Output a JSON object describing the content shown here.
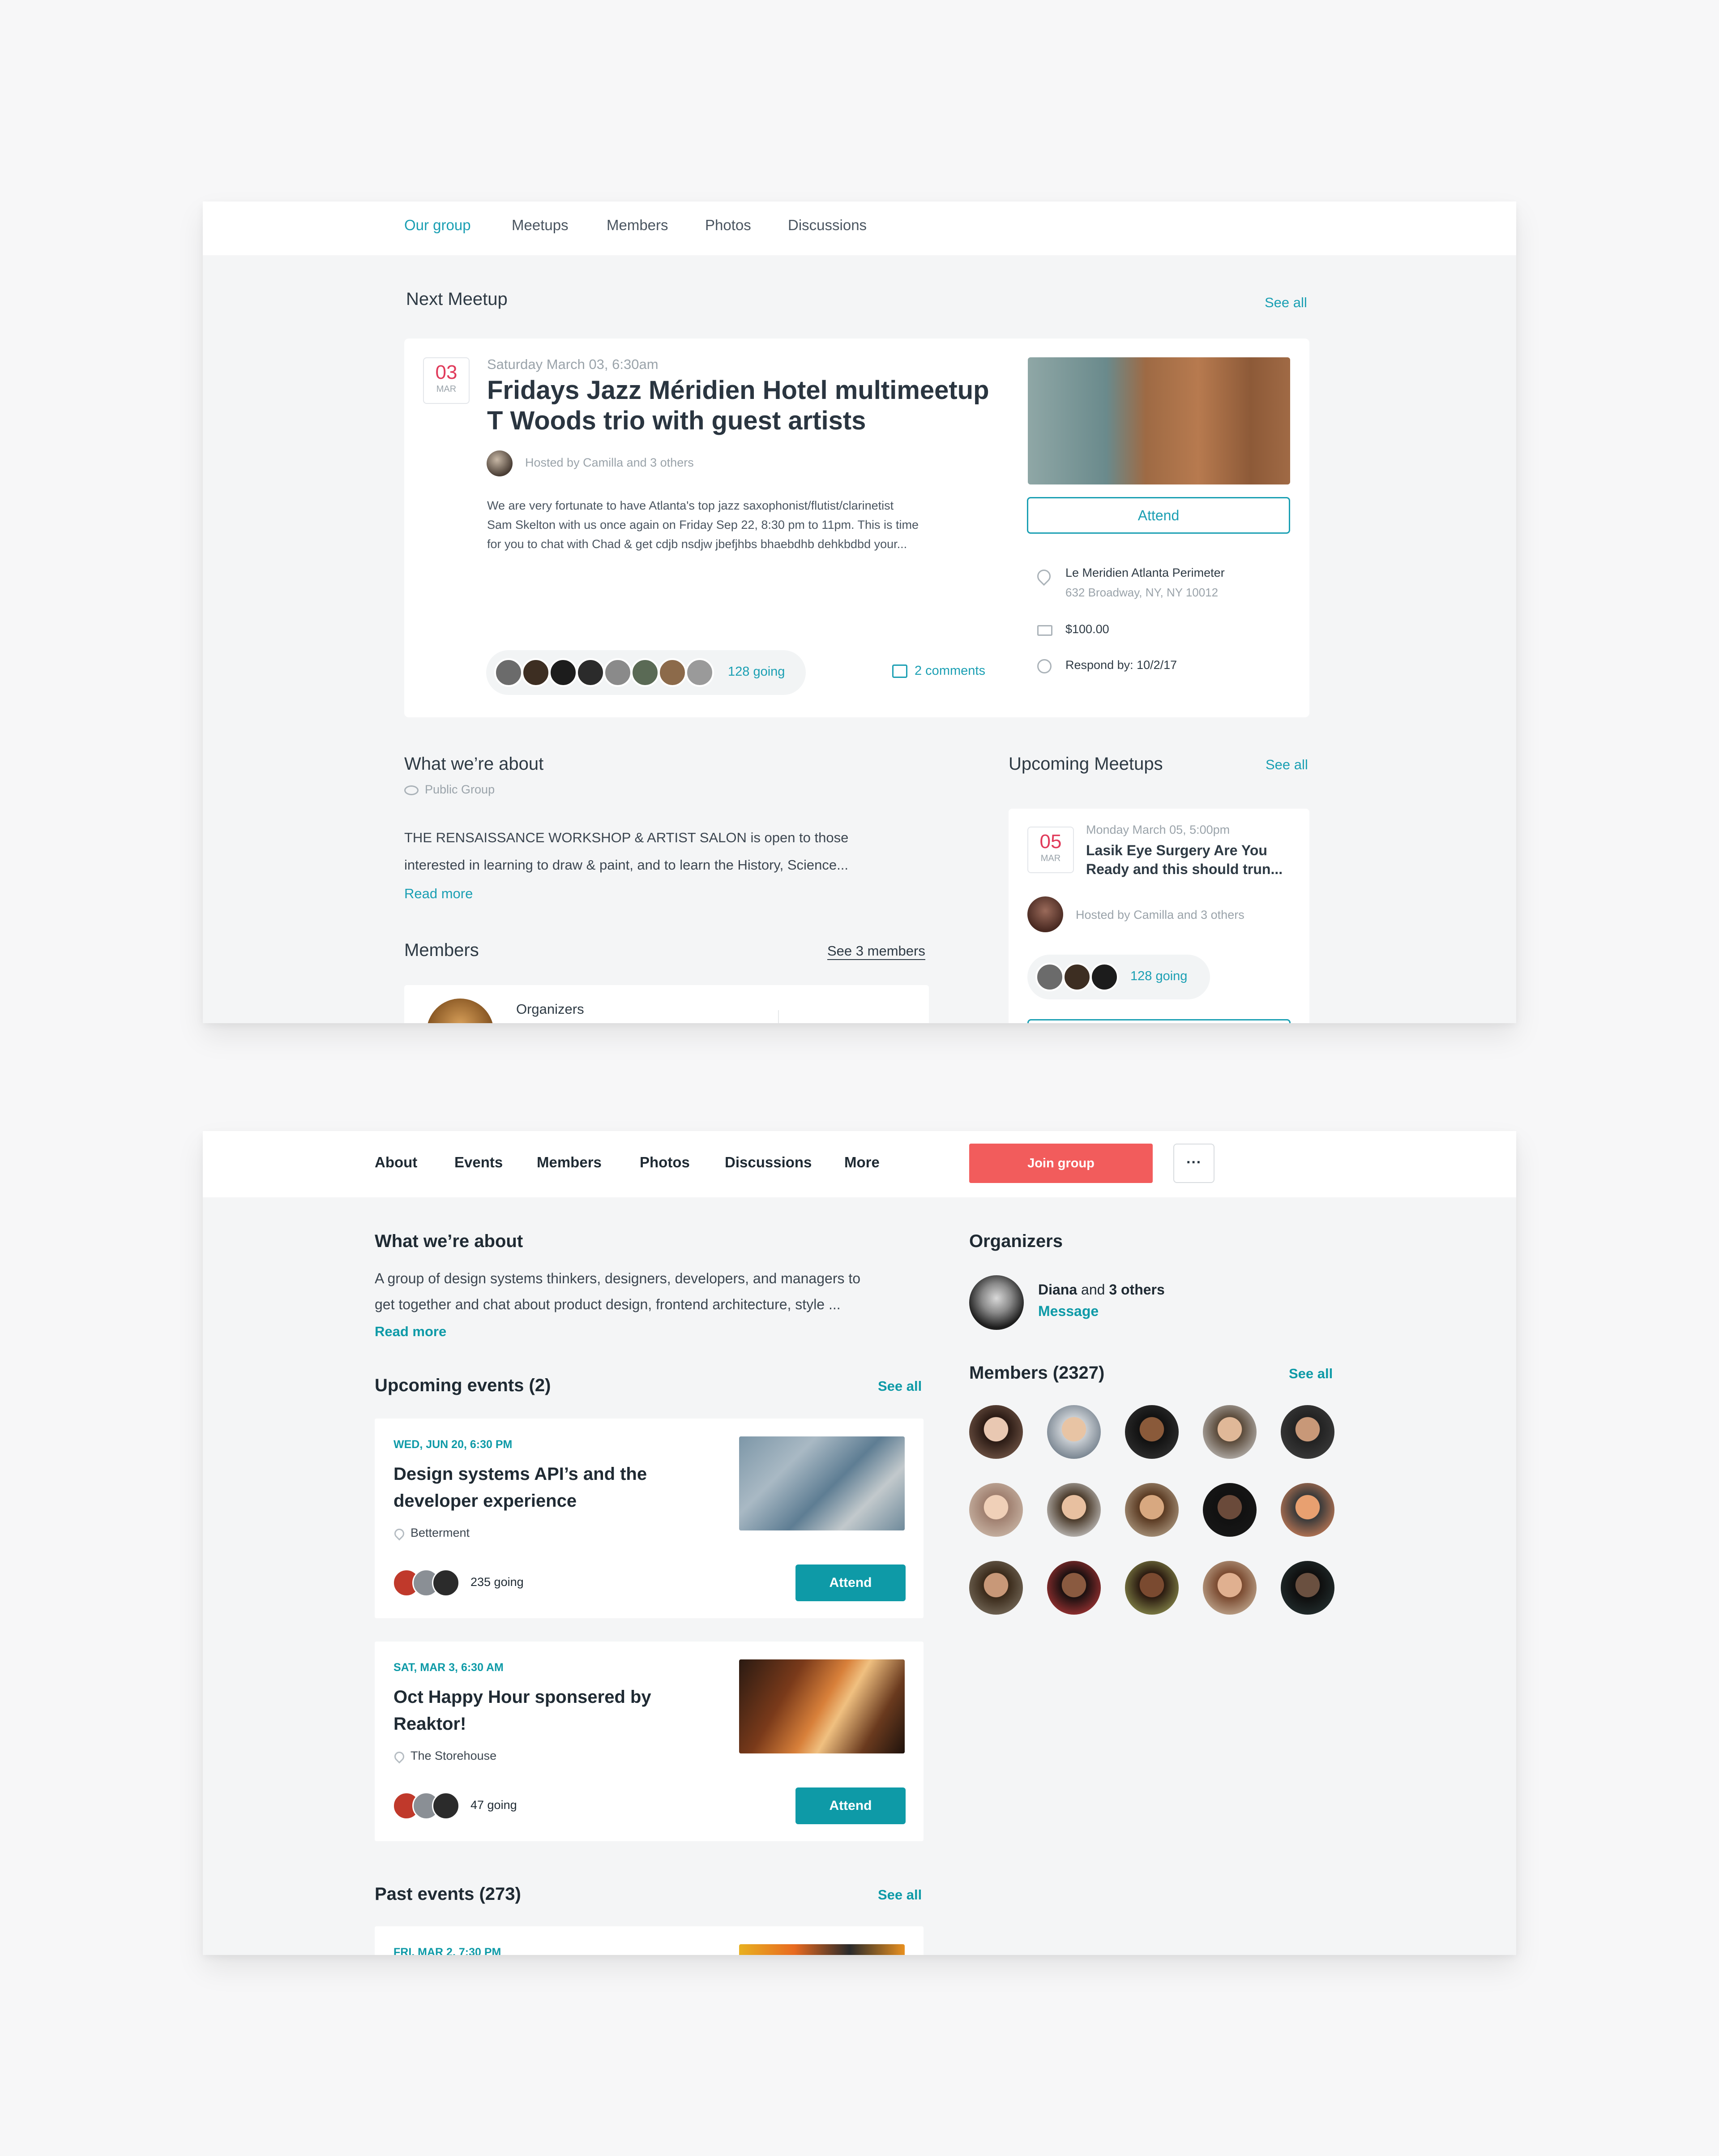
{
  "panel1": {
    "nav": [
      "Our group",
      "Meetups",
      "Members",
      "Photos",
      "Discussions"
    ],
    "next_meetup": {
      "heading": "Next Meetup",
      "see_all": "See all",
      "date_day": "03",
      "date_month": "MAR",
      "datetime": "Saturday March 03, 6:30am",
      "title_line1": "Fridays Jazz Méridien Hotel multimeetup",
      "title_line2": "T Woods trio with guest artists",
      "hosted": "Hosted by Camilla and 3 others",
      "desc1": "We are very fortunate to have Atlanta's top jazz saxophonist/flutist/clarinetist",
      "desc2": "Sam Skelton with us once again on Friday Sep 22, 8:30 pm to 11pm. This is time",
      "desc3": "for you to chat with Chad & get cdjb nsdjw jbefjhbs bhaebdhb dehkbdbd your...",
      "going": "128 going",
      "comments": "2 comments",
      "attend": "Attend",
      "venue": "Le Meridien Atlanta Perimeter",
      "address": "632 Broadway, NY, NY 10012",
      "price": "$100.00",
      "respond": "Respond by: 10/2/17"
    },
    "about": {
      "heading": "What we’re about",
      "visibility": "Public Group",
      "text1": "THE RENSAISSANCE WORKSHOP & ARTIST SALON is open to those",
      "text2": "interested in learning to draw & paint, and to learn the History, Science...",
      "read_more": "Read more"
    },
    "members": {
      "heading": "Members",
      "see": "See 3 members",
      "organizers": "Organizers"
    },
    "upcoming": {
      "heading": "Upcoming Meetups",
      "see_all": "See all",
      "date_day": "05",
      "date_month": "MAR",
      "datetime": "Monday March 05, 5:00pm",
      "title_line1": "Lasik Eye Surgery Are You",
      "title_line2": "Ready and this should trun...",
      "hosted": "Hosted by Camilla and 3 others",
      "going": "128 going"
    }
  },
  "panel2": {
    "nav": [
      "About",
      "Events",
      "Members",
      "Photos",
      "Discussions",
      "More"
    ],
    "join": "Join group",
    "more_dots": "···",
    "about": {
      "heading": "What we’re about",
      "text1": "A group of design systems thinkers, designers, developers, and managers to",
      "text2": "get together and chat about product design, frontend architecture, style ...",
      "read_more": "Read more"
    },
    "upcoming": {
      "heading": "Upcoming events (2)",
      "see_all": "See all",
      "events": [
        {
          "date": "WED, JUN 20, 6:30 PM",
          "title1": "Design systems API’s and the",
          "title2": "developer experience",
          "venue": "Betterment",
          "going": "235 going",
          "attend": "Attend"
        },
        {
          "date": "SAT, MAR 3, 6:30 AM",
          "title1": "Oct Happy Hour sponsered by",
          "title2": "Reaktor!",
          "venue": "The Storehouse",
          "going": "47 going",
          "attend": "Attend"
        }
      ]
    },
    "past": {
      "heading": "Past events (273)",
      "see_all": "See all",
      "next_date": "FRI, MAR 2, 7:30 PM"
    },
    "organizers": {
      "heading": "Organizers",
      "name": "Diana",
      "and": "and",
      "others": "3 others",
      "message": "Message"
    },
    "members": {
      "heading": "Members (2327)",
      "see_all": "See all"
    }
  },
  "colors": {
    "accent": "#1a9fb3",
    "join": "#f25c5c",
    "date_red": "#e03a5a",
    "attend_fill": "#0e9aa7"
  }
}
